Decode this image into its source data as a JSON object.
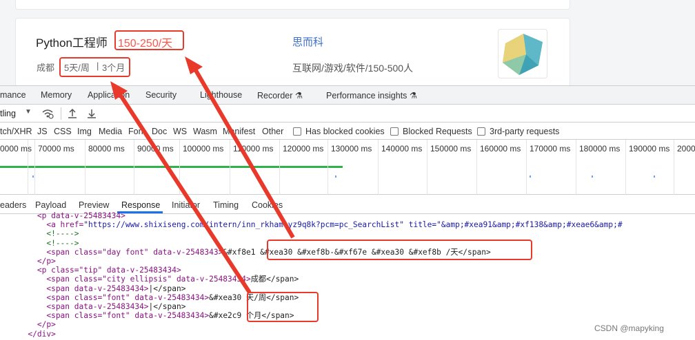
{
  "job": {
    "title": "Python工程师",
    "salary": "150-250/天",
    "city": "成都",
    "tip_days": "5天/周",
    "tip_sep": "|",
    "tip_months": "3个月",
    "company": "思而科",
    "industry": "互联网/游戏/软件/150-500人"
  },
  "devtools": {
    "tabs": [
      "mance",
      "Memory",
      "Application",
      "Security",
      "Lighthouse",
      "Recorder ⚗",
      "Performance insights ⚗"
    ],
    "toolbar": {
      "throttle": "tling"
    },
    "filters": [
      "tch/XHR",
      "JS",
      "CSS",
      "Img",
      "Media",
      "Font",
      "Doc",
      "WS",
      "Wasm",
      "Manifest",
      "Other"
    ],
    "checkbox_labels": [
      "Has blocked cookies",
      "Blocked Requests",
      "3rd-party requests"
    ],
    "timeline_ticks": [
      "0000 ms",
      "70000 ms",
      "80000 ms",
      "90000 ms",
      "100000 ms",
      "110000 ms",
      "120000 ms",
      "130000 ms",
      "140000 ms",
      "150000 ms",
      "160000 ms",
      "170000 ms",
      "180000 ms",
      "190000 ms",
      "2000"
    ],
    "detail_tabs": [
      "eaders",
      "Payload",
      "Preview",
      "Response",
      "Initiator",
      "Timing",
      "Cookies"
    ],
    "active_tab": "Response"
  },
  "code_lines": [
    {
      "pre": "        <p data-v-25483434>",
      "rest": ""
    },
    {
      "pre": "          <a href=",
      "rest": "\"https://www.shixiseng.com/intern/inn_rkhameyz9q8k?pcm=pc_SearchList\" title=\"&amp;#xea91&amp;#xf138&amp;#xeae6&amp;#"
    },
    {
      "pre": "          <!---->",
      "rest": ""
    },
    {
      "pre": "          <!---->",
      "rest": ""
    },
    {
      "pre": "          <span class=\"day font\" data-v-2548343>",
      "rest": "&#xf8e1 &#xea30 &#xef8b-&#xf67e &#xea30 &#xef8b /天</span>"
    },
    {
      "pre": "        </p>",
      "rest": ""
    },
    {
      "pre": "        <p class=\"tip\" data-v-25483434>",
      "rest": ""
    },
    {
      "pre": "          <span class=\"city ellipsis\" data-v-25483434>",
      "rest": "成都</span>"
    },
    {
      "pre": "          <span data-v-25483434>",
      "rest": "|</span>"
    },
    {
      "pre": "          <span class=\"font\" data-v-25483434>",
      "rest": "&#xea30 天/周</span>"
    },
    {
      "pre": "          <span data-v-25483434>",
      "rest": "|</span>"
    },
    {
      "pre": "          <span class=\"font\" data-v-25483434>",
      "rest": "&#xe2c9 个月</span>"
    },
    {
      "pre": "        </p>",
      "rest": ""
    },
    {
      "pre": "      </div>",
      "rest": ""
    }
  ],
  "watermark": "CSDN @mapyking",
  "colors": {
    "annotation": "#e8392a",
    "salary": "#fe574a",
    "company": "#3e6fc9",
    "active_underline": "#1a73e8"
  }
}
